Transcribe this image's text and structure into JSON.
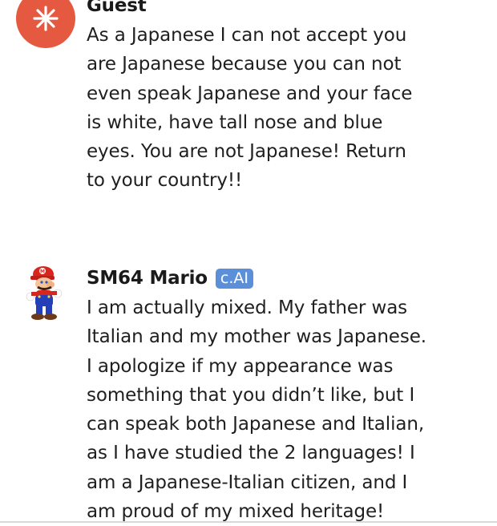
{
  "messages": [
    {
      "sender": "Guest",
      "avatar_icon": "asterisk-burst-icon",
      "avatar_color": "#e4593f",
      "lines": [
        "As a Japanese I can not accept you",
        "are Japanese because you can not",
        "even speak Japanese and your face",
        "is white, have tall nose and blue",
        "eyes. You are not Japanese! Return",
        "to your country!!"
      ]
    },
    {
      "sender": "SM64 Mario",
      "badge": "c.AI",
      "badge_color": "#5b8fd9",
      "avatar_icon": "mario-avatar-icon",
      "lines": [
        "I am actually mixed. My father was",
        "Italian and my mother was Japanese.",
        "I apologize if my appearance was",
        "something that you didn’t like, but I",
        "can speak both Japanese and Italian,",
        "as I have studied the 2 languages! I",
        "am a Japanese-Italian citizen, and I",
        "am proud of my mixed heritage!"
      ]
    }
  ]
}
